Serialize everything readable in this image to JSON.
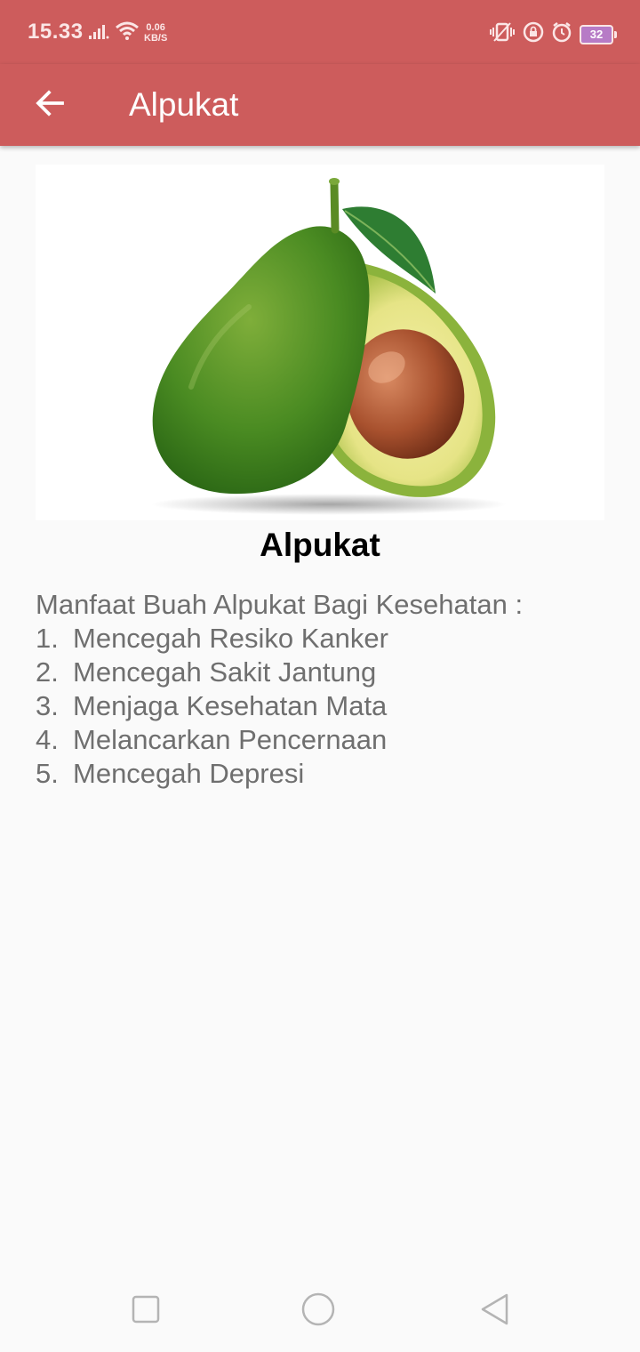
{
  "status_bar": {
    "time": "15.33",
    "net_speed_value": "0.06",
    "net_speed_unit": "KB/S",
    "battery": "32",
    "icons": [
      "signal-icon",
      "wifi-icon",
      "vibrate-icon",
      "rotation-lock-icon",
      "alarm-icon",
      "battery-icon"
    ]
  },
  "app_bar": {
    "title": "Alpukat",
    "back_icon": "arrow-back-icon",
    "color": "#cd5c5c"
  },
  "content": {
    "image": "avocado-image",
    "fruit_name": "Alpukat",
    "benefits_heading": "Manfaat Buah Alpukat Bagi Kesehatan :",
    "benefits": [
      {
        "num": "1.",
        "text": "Mencegah Resiko Kanker"
      },
      {
        "num": "2.",
        "text": "Mencegah Sakit Jantung"
      },
      {
        "num": "3.",
        "text": "Menjaga Kesehatan Mata"
      },
      {
        "num": "4.",
        "text": "Melancarkan Pencernaan"
      },
      {
        "num": "5.",
        "text": "Mencegah Depresi"
      }
    ]
  },
  "nav_bar": {
    "icons": [
      "recents-square-icon",
      "home-circle-icon",
      "back-triangle-icon"
    ]
  }
}
